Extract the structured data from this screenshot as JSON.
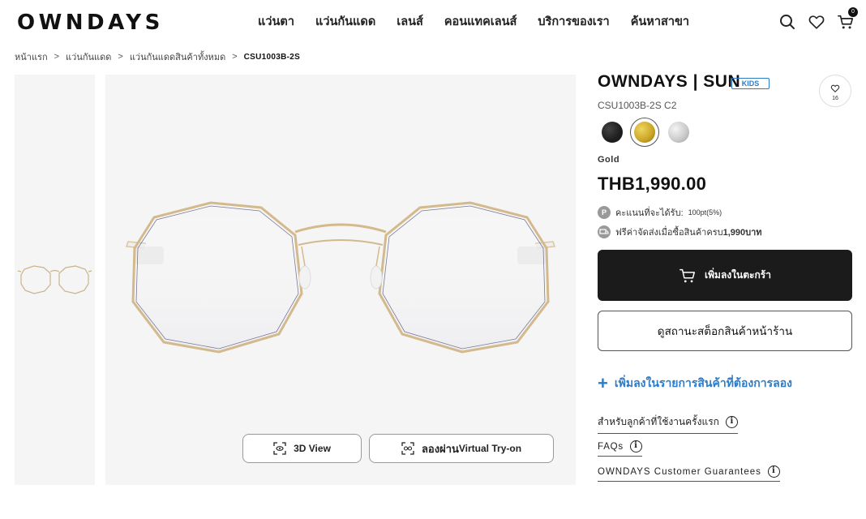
{
  "header": {
    "logo": "OWNDAYS",
    "nav": [
      "แว่นตา",
      "แว่นกันแดด",
      "เลนส์",
      "คอนแทคเลนส์",
      "บริการของเรา",
      "ค้นหาสาขา"
    ],
    "cart_count": "0",
    "icons": [
      "search-icon",
      "heart-icon",
      "cart-icon"
    ]
  },
  "breadcrumb": [
    "หน้าแรก",
    "แว่นกันแดด",
    "แว่นกันแดดสินค้าทั้งหมด",
    "CSU1003B-2S"
  ],
  "breadcrumb_sep": ">",
  "gallery": {
    "btn_3d": "3D View",
    "btn_tryon_th": "ลองผ่าน",
    "btn_tryon_en": "Virtual Try-on"
  },
  "product": {
    "title": "OWNDAYS | SUN",
    "badge": "KIDS",
    "favorites": "16",
    "sku": "CSU1003B-2S C2",
    "color_name": "Gold",
    "swatch_colors": [
      "#1d1d1d",
      "#c9a425",
      "#c8c8c8"
    ],
    "selected_swatch": 1,
    "price": "THB1,990.00",
    "points_label": "คะแนนที่จะได้รับ:",
    "points_value": "100pt(5%)",
    "points_icon": "P",
    "shipping_text": "ฟรีค่าจัดส่งเมื่อซื้อสินค้าครบ",
    "shipping_amount": "1,990บาท",
    "add_to_cart": "เพิ่มลงในตะกร้า",
    "check_stock": "ดูสถานะสต็อกสินค้าหน้าร้าน",
    "wishlist": "เพิ่มลงในรายการสินค้าที่ต้องการลอง",
    "first_time": "สำหรับลูกค้าที่ใช้งานครั้งแรก",
    "faqs": "FAQs",
    "guarantees": "OWNDAYS Customer Guarantees"
  },
  "colors": {
    "accent_blue": "#2e7cc6",
    "cart_button": "#1b1b1b",
    "gallery_bg": "#f5f5f5"
  }
}
